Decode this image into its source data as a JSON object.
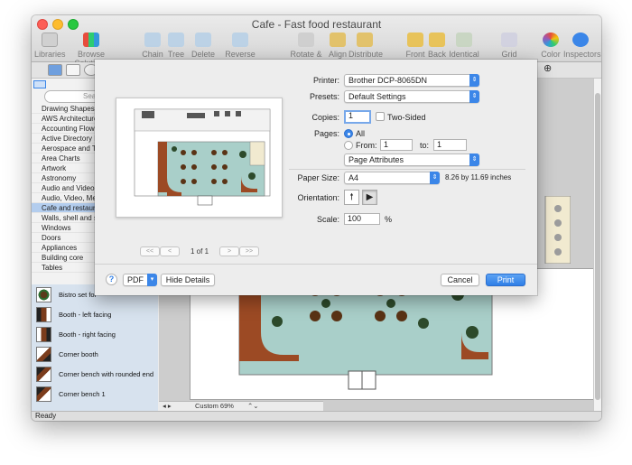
{
  "window": {
    "title": "Cafe - Fast food restaurant"
  },
  "toolbar": {
    "items": [
      {
        "label": "Libraries",
        "icon": "libraries-icon"
      },
      {
        "label": "Browse Solutions",
        "icon": "browse-solutions-icon"
      },
      {
        "label": "Chain",
        "icon": "chain-icon"
      },
      {
        "label": "Tree",
        "icon": "tree-icon"
      },
      {
        "label": "Delete link",
        "icon": "delete-link-icon"
      },
      {
        "label": "Reverse link",
        "icon": "reverse-link-icon"
      },
      {
        "label": "Rotate & Flip",
        "icon": "rotate-flip-icon"
      },
      {
        "label": "Align",
        "icon": "align-icon"
      },
      {
        "label": "Distribute",
        "icon": "distribute-icon"
      },
      {
        "label": "Front",
        "icon": "front-icon"
      },
      {
        "label": "Back",
        "icon": "back-icon"
      },
      {
        "label": "Identical",
        "icon": "identical-icon"
      },
      {
        "label": "Grid",
        "icon": "grid-icon"
      },
      {
        "label": "Color",
        "icon": "color-icon"
      },
      {
        "label": "Inspectors",
        "icon": "inspectors-icon"
      }
    ]
  },
  "sidebar": {
    "search_placeholder": "Sea",
    "libraries": [
      "Drawing Shapes",
      "AWS Architecture D",
      "Accounting Flowch",
      "Active Directory Di",
      "Aerospace and Tra",
      "Area Charts",
      "Artwork",
      "Astronomy",
      "Audio and Video C",
      "Audio, Video, Medi",
      "Cafe and restaura",
      "Walls, shell and s",
      "Windows",
      "Doors",
      "Appliances",
      "Building core",
      "Tables"
    ],
    "selected_library": "Cafe and restaura",
    "shapes": [
      "Bistro set for",
      "Booth - left facing",
      "Booth - right facing",
      "Corner booth",
      "Corner bench with rounded end",
      "Corner bench 1"
    ]
  },
  "status": {
    "text": "Ready",
    "zoom": "Custom 69%"
  },
  "print_dialog": {
    "printer_label": "Printer:",
    "printer_value": "Brother DCP-8065DN",
    "presets_label": "Presets:",
    "presets_value": "Default Settings",
    "copies_label": "Copies:",
    "copies_value": "1",
    "two_sided_label": "Two-Sided",
    "pages_label": "Pages:",
    "pages_all": "All",
    "pages_from": "From:",
    "from_value": "1",
    "to_label": "to:",
    "to_value": "1",
    "section_value": "Page Attributes",
    "paper_size_label": "Paper Size:",
    "paper_size_value": "A4",
    "paper_dims": "8.26 by 11.69 inches",
    "orientation_label": "Orientation:",
    "scale_label": "Scale:",
    "scale_value": "100",
    "scale_unit": "%",
    "page_indicator": "1 of 1",
    "pager_first": "<<",
    "pager_prev": "<",
    "pager_next": ">",
    "pager_last": ">>",
    "help": "?",
    "pdf": "PDF",
    "hide_details": "Hide Details",
    "cancel": "Cancel",
    "print": "Print"
  }
}
